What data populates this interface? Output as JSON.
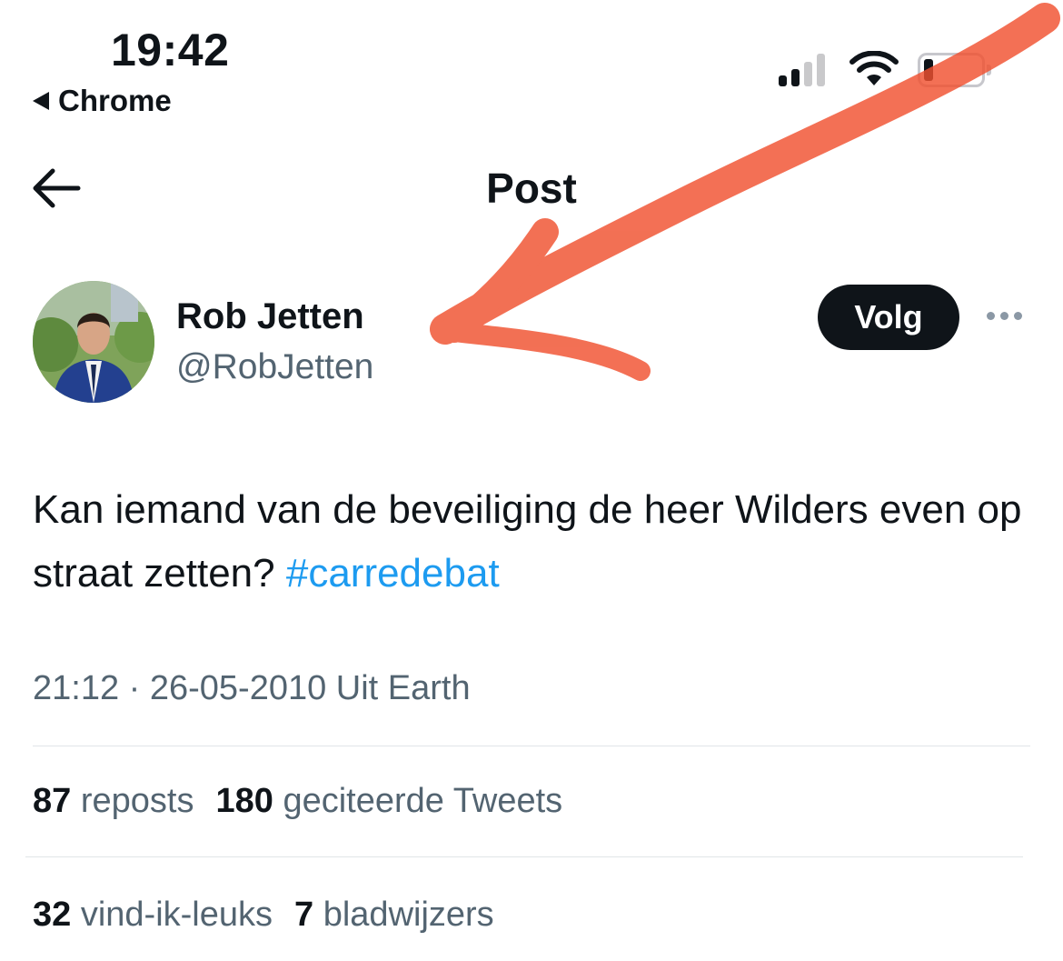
{
  "status_bar": {
    "time": "19:42",
    "back_app": "Chrome"
  },
  "header": {
    "title": "Post",
    "back_icon": "arrow-left-icon"
  },
  "author": {
    "name": "Rob Jetten",
    "handle": "@RobJetten",
    "follow_label": "Volg"
  },
  "tweet": {
    "text_part": "Kan iemand van de beveiliging de heer Wilders even op straat zetten?",
    "hashtag": "#carredebat"
  },
  "meta": {
    "timestamp": "21:12 · 26-05-2010 Uit Earth"
  },
  "stats": {
    "reposts_count": "87",
    "reposts_label": "reposts",
    "quotes_count": "180",
    "quotes_label": "geciteerde Tweets",
    "likes_count": "32",
    "likes_label": "vind-ik-leuks",
    "bookmarks_count": "7",
    "bookmarks_label": "bladwijzers"
  },
  "colors": {
    "accent": "#1d9bf0",
    "annotation": "#f0512f",
    "text_primary": "#0f1419",
    "text_secondary": "#536471"
  }
}
